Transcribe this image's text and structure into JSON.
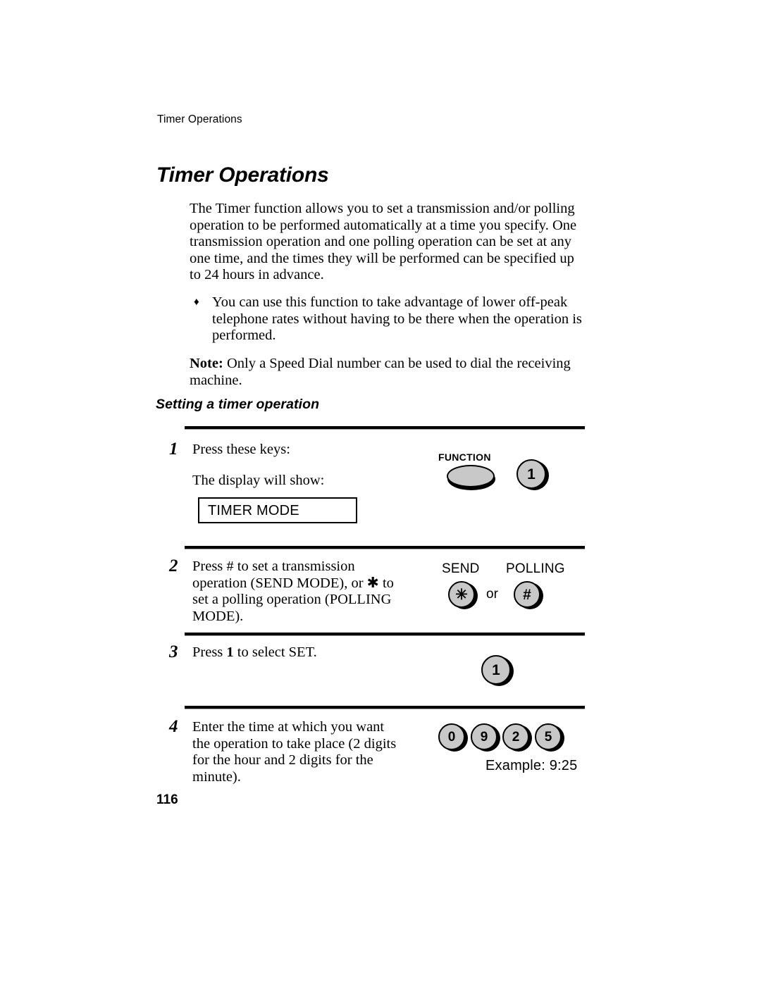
{
  "page": {
    "running_header": "Timer Operations",
    "chapter_title": "Timer Operations",
    "page_number": "116"
  },
  "intro": {
    "paragraph": "The Timer function allows you to set a transmission and/or polling operation to be performed automatically at a time you specify. One transmission operation and one polling operation can be set at any one time, and the times they will be performed can be specified up to 24 hours in advance.",
    "bullet_glyph": "♦",
    "bullet_text": "You can use this function to take advantage of lower off-peak telephone rates without having to be there when the operation is performed.",
    "note_label": "Note:",
    "note_text": " Only a Speed Dial number can be used to dial the receiving machine."
  },
  "section": {
    "heading": "Setting a timer operation"
  },
  "steps": [
    {
      "number": "1",
      "text": "Press these keys:",
      "secondary_text": "The display will show:",
      "display_value": "TIMER MODE",
      "keys": [
        {
          "label": "FUNCTION",
          "cap": "",
          "shape": "oval"
        },
        {
          "label": "",
          "cap": "1",
          "shape": "round"
        }
      ]
    },
    {
      "number": "2",
      "text": "Press # to set a transmission operation (SEND MODE), or ✱ to set a polling operation (POLLING MODE).",
      "keys": [
        {
          "label": "SEND",
          "cap": "✳",
          "shape": "round"
        },
        {
          "label": "POLLING",
          "cap": "#",
          "shape": "round"
        }
      ],
      "connector": "or"
    },
    {
      "number": "3",
      "text_before": "Press ",
      "text_bold": "1",
      "text_after": " to select SET.",
      "keys": [
        {
          "label": "",
          "cap": "1",
          "shape": "round"
        }
      ]
    },
    {
      "number": "4",
      "text": "Enter the time at which you want the operation to take place (2 digits for the hour and 2 digits for the minute).",
      "keys": [
        {
          "label": "",
          "cap": "0",
          "shape": "round"
        },
        {
          "label": "",
          "cap": "9",
          "shape": "round"
        },
        {
          "label": "",
          "cap": "2",
          "shape": "round"
        },
        {
          "label": "",
          "cap": "5",
          "shape": "round"
        }
      ],
      "caption": "Example: 9:25"
    }
  ],
  "colors": {
    "key_face": "#c8c8c8",
    "ink": "#000000",
    "paper": "#ffffff"
  }
}
